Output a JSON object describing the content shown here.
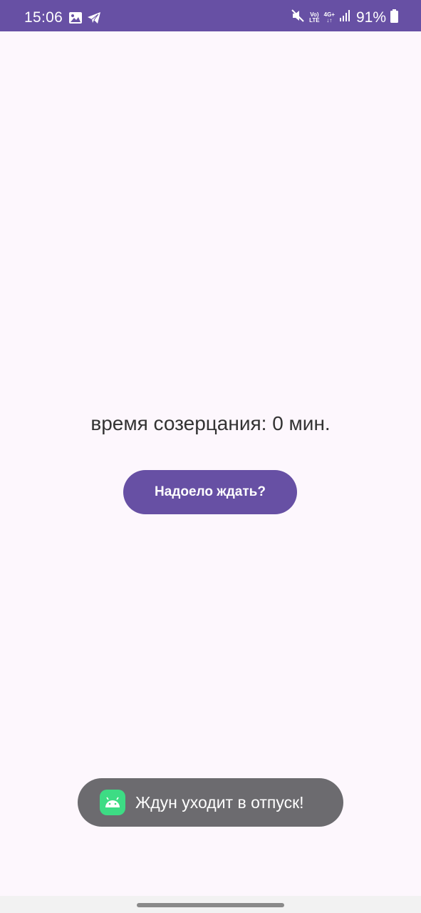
{
  "status_bar": {
    "time": "15:06",
    "volte_top": "Vo)",
    "volte_bottom": "LTE",
    "network": "4G+",
    "battery": "91%"
  },
  "main": {
    "label": "время созерцания: 0 мин.",
    "button_label": "Надоело ждать?"
  },
  "toast": {
    "message": "Ждун уходит в отпуск!"
  },
  "colors": {
    "accent": "#6750a4",
    "background": "#fdf7fd",
    "toast_bg": "#6c6b6f",
    "android_green": "#3ddc84"
  }
}
